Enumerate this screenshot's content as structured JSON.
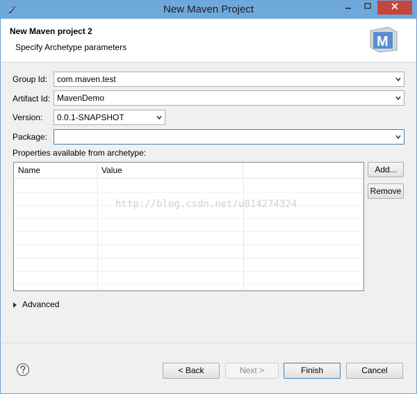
{
  "window": {
    "title": "New Maven Project"
  },
  "header": {
    "title": "New Maven project 2",
    "subtitle": "Specify Archetype parameters"
  },
  "form": {
    "group_id": {
      "label": "Group Id:",
      "value": "com.maven.test"
    },
    "artifact_id": {
      "label": "Artifact Id:",
      "value": "MavenDemo"
    },
    "version": {
      "label": "Version:",
      "value": "0.0.1-SNAPSHOT"
    },
    "package": {
      "label": "Package:",
      "value": ""
    },
    "properties_label": "Properties available from archetype:"
  },
  "table": {
    "columns": [
      "Name",
      "Value"
    ],
    "buttons": {
      "add": "Add...",
      "remove": "Remove"
    }
  },
  "watermark": "http://blog.csdn.net/u014274324",
  "advanced": {
    "label": "Advanced"
  },
  "footer": {
    "back": "< Back",
    "next": "Next >",
    "finish": "Finish",
    "cancel": "Cancel"
  },
  "colors": {
    "titlebar": "#6ea9dc",
    "close_button": "#c7463b",
    "focus_border": "#3c7fb1"
  },
  "icons": [
    "eclipse-app-icon",
    "maven-logo-icon",
    "chevron-down-icon",
    "help-icon",
    "expand-triangle-icon"
  ]
}
